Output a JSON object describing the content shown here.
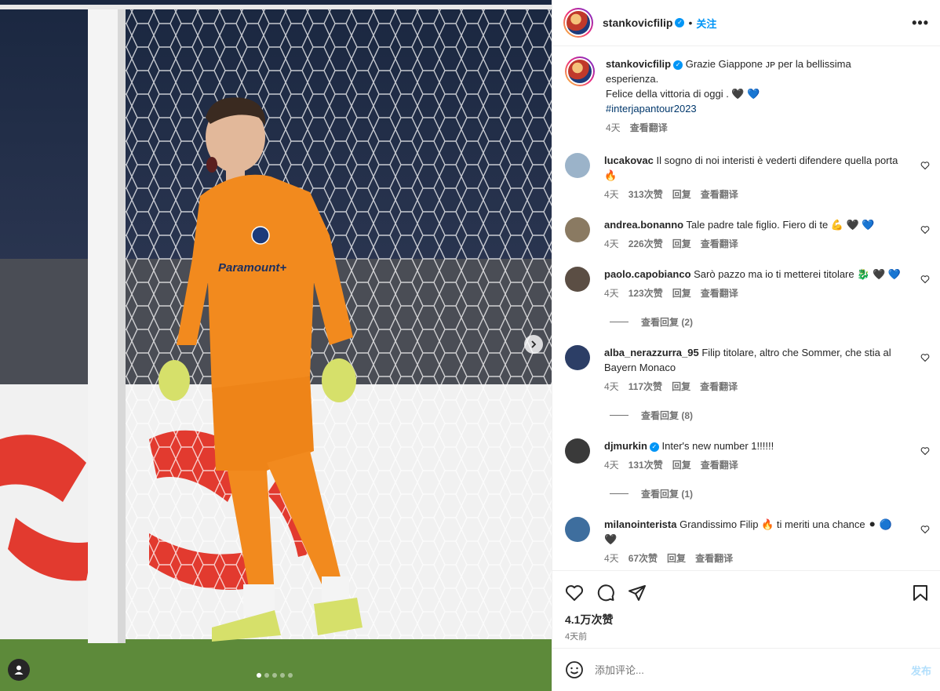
{
  "post": {
    "username": "stankovicfilip",
    "follow_label": "关注",
    "more_label": "•••",
    "caption_line1": "Grazie Giappone ᴊᴘ per la bellissima esperienza.",
    "caption_line2": "Felice della vittoria di oggi . 🖤 💙",
    "caption_hashtag": "#interjapantour2023",
    "caption_time": "4天",
    "caption_translate": "查看翻译"
  },
  "comments": [
    {
      "user": "lucakovac",
      "verified": false,
      "text": "Il sogno di noi interisti è vederti difendere quella porta 🔥",
      "time": "4天",
      "likes": "313次赞",
      "reply": "回复",
      "translate": "查看翻译",
      "avatar_color": "#9bb3c9"
    },
    {
      "user": "andrea.bonanno",
      "verified": false,
      "text": "Tale padre tale figlio. Fiero di te 💪 🖤 💙",
      "time": "4天",
      "likes": "226次赞",
      "reply": "回复",
      "translate": "查看翻译",
      "avatar_color": "#8a7a62"
    },
    {
      "user": "paolo.capobianco",
      "verified": false,
      "text": "Sarò pazzo ma io ti metterei titolare 🐉 🖤 💙",
      "time": "4天",
      "likes": "123次赞",
      "reply": "回复",
      "translate": "查看翻译",
      "view_replies": "查看回复 (2)",
      "avatar_color": "#5b4e44"
    },
    {
      "user": "alba_nerazzurra_95",
      "verified": false,
      "text": "Filip titolare, altro che Sommer, che stia al Bayern Monaco",
      "time": "4天",
      "likes": "117次赞",
      "reply": "回复",
      "translate": "查看翻译",
      "view_replies": "查看回复 (8)",
      "avatar_color": "#2c3e66"
    },
    {
      "user": "djmurkin",
      "verified": true,
      "text": "Inter's new number 1!!!!!!",
      "time": "4天",
      "likes": "131次赞",
      "reply": "回复",
      "translate": "查看翻译",
      "view_replies": "查看回复 (1)",
      "avatar_color": "#3a3a3a"
    },
    {
      "user": "milanointerista",
      "verified": false,
      "text": "Grandissimo Filip 🔥 ti meriti una chance ⚫ 🔵 🖤",
      "time": "4天",
      "likes": "67次赞",
      "reply": "回复",
      "translate": "查看翻译",
      "avatar_color": "#3e6e9e"
    }
  ],
  "actions": {
    "likes_count": "4.1万次赞",
    "date": "4天前"
  },
  "add_comment": {
    "placeholder": "添加评论...",
    "post_label": "发布"
  },
  "media": {
    "jersey_sponsor": "Paramount+",
    "slide_index": 1,
    "slide_count": 5
  }
}
